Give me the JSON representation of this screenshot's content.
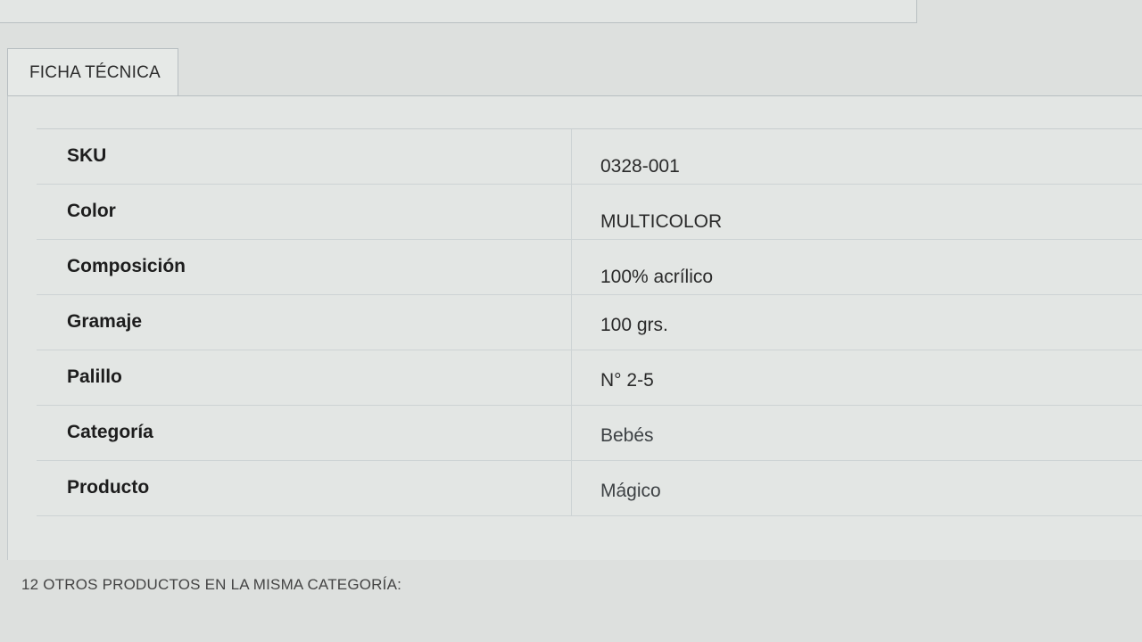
{
  "tab": {
    "label": "FICHA TÉCNICA"
  },
  "specs": [
    {
      "label": "SKU",
      "value": "0328-001"
    },
    {
      "label": "Color",
      "value": "MULTICOLOR"
    },
    {
      "label": "Composición",
      "value": "100% acrílico"
    },
    {
      "label": "Gramaje",
      "value": "100 grs."
    },
    {
      "label": "Palillo",
      "value": "N° 2-5"
    },
    {
      "label": "Categoría",
      "value": "Bebés"
    },
    {
      "label": "Producto",
      "value": "Mágico"
    }
  ],
  "footer": {
    "heading": "12 OTROS PRODUCTOS EN LA MISMA CATEGORÍA:"
  }
}
